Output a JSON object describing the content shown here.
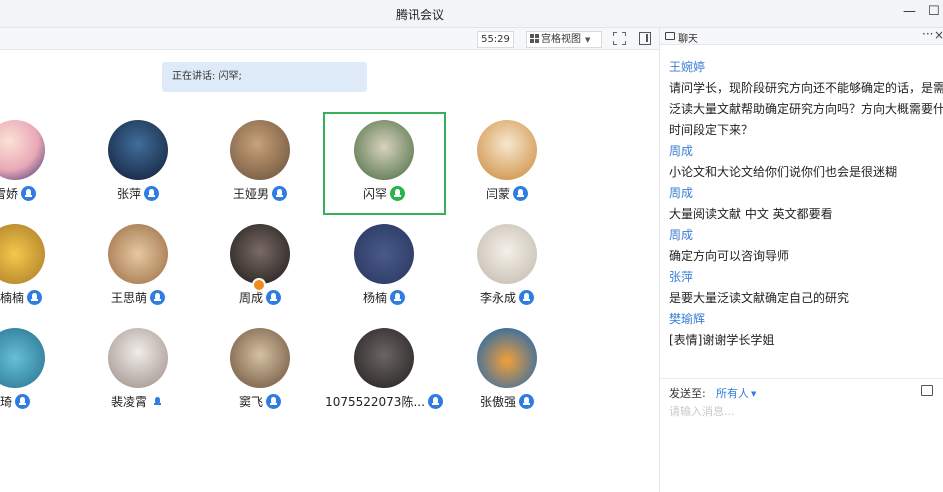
{
  "window": {
    "title": "腾讯会议",
    "minimize": "—",
    "maximize": "☐"
  },
  "toolbar": {
    "timer": "55:29",
    "view_label": "宫格视图"
  },
  "speaking": "正在讲话: 闪罕;",
  "participants": [
    {
      "name": "雪娇",
      "mic": "on"
    },
    {
      "name": "张萍",
      "mic": "on"
    },
    {
      "name": "王娅男",
      "mic": "on"
    },
    {
      "name": "闪罕",
      "mic": "speaking"
    },
    {
      "name": "闫蒙",
      "mic": "on"
    },
    {
      "name": "周楠楠",
      "mic": "on"
    },
    {
      "name": "王思萌",
      "mic": "on"
    },
    {
      "name": "周成",
      "mic": "on"
    },
    {
      "name": "杨楠",
      "mic": "on"
    },
    {
      "name": "李永成",
      "mic": "on"
    },
    {
      "name": "琦",
      "mic": "on"
    },
    {
      "name": "裴凌霄",
      "mic": "plain"
    },
    {
      "name": "窦飞",
      "mic": "on"
    },
    {
      "name": "1075522073陈...",
      "mic": "on"
    },
    {
      "name": "张傲强",
      "mic": "on"
    }
  ],
  "chat": {
    "title": "聊天",
    "more": "···",
    "close": "×",
    "messages": [
      {
        "sender": "王婉婷",
        "lines": [
          "请问学长，现阶段研究方向还不能够确定的话，是需",
          "泛读大量文献帮助确定研究方向吗？方向大概需要什",
          "时间段定下来？"
        ]
      },
      {
        "sender": "周成",
        "lines": [
          "小论文和大论文给你们说你们也会是很迷糊"
        ]
      },
      {
        "sender": "周成",
        "lines": [
          "大量阅读文献  中文 英文都要看"
        ]
      },
      {
        "sender": "周成",
        "lines": [
          "确定方向可以咨询导师"
        ]
      },
      {
        "sender": "张萍",
        "lines": [
          "是要大量泛读文献确定自己的研究"
        ]
      },
      {
        "sender": "樊瑜辉",
        "lines": [
          "[表情]谢谢学长学姐"
        ]
      }
    ],
    "send_label": "发送至:",
    "send_target": "所有人",
    "placeholder": "请输入消息..."
  }
}
